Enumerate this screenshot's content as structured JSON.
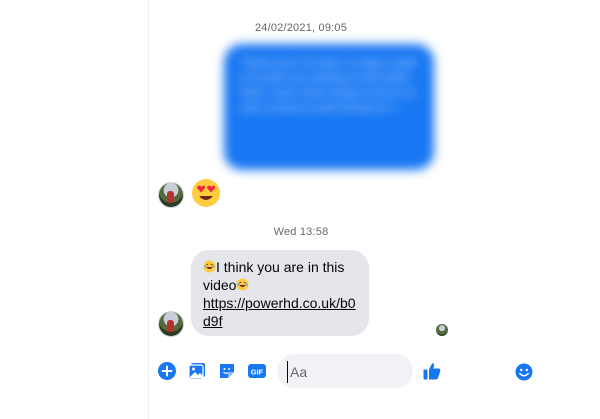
{
  "conversation": {
    "timestamp_1": "24/02/2021, 09:05",
    "timestamp_2": "Wed 13:58",
    "outgoing_blurred_text": "Thank you!! It's been a rough couple of months but starting to feel better. Wish I have some things to focus on and a house to look forward to x",
    "incoming_message": {
      "text_line_1": "I think you are in this",
      "text_line_2": "video",
      "link": "https://powerhd.co.uk/b0d9f"
    }
  },
  "composer": {
    "placeholder": "Aa"
  },
  "colors": {
    "accent": "#1877f2",
    "incoming_bubble": "#e4e6eb",
    "timestamp": "#65676b"
  },
  "icons": [
    "plus-icon",
    "photo-icon",
    "sticker-icon",
    "gif-icon",
    "emoji-icon",
    "thumbs-up-icon",
    "heart-eyes-emoji",
    "laughing-emoji"
  ]
}
